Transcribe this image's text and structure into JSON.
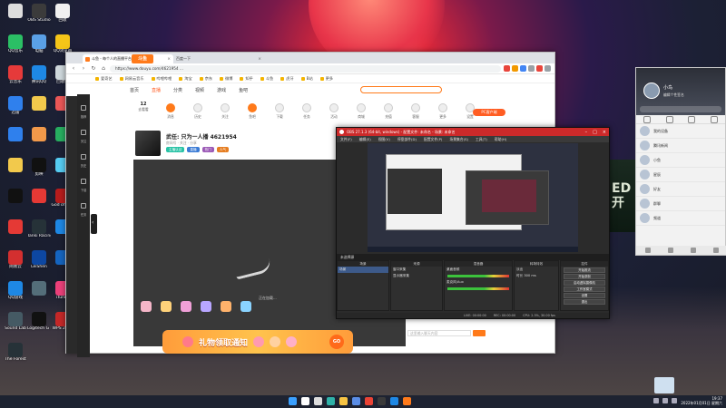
{
  "desktop": {
    "icons": [
      {
        "label": "",
        "color": "#dddddd"
      },
      {
        "label": "OBS Studio",
        "color": "#3b3b3b"
      },
      {
        "label": "回收",
        "color": "#f0f0f0"
      },
      {
        "label": "斗鱼直播",
        "color": "#ff7a1a"
      },
      {
        "label": "QQ音乐",
        "color": "#2bbf65"
      },
      {
        "label": "电脑",
        "color": "#5aa0e6"
      },
      {
        "label": "QQ浏览器",
        "color": "#f5c518"
      },
      {
        "label": "斗鱼助手",
        "color": "#3a8ee6"
      },
      {
        "label": "云音乐",
        "color": "#e63a3a"
      },
      {
        "label": "腾讯QQ",
        "color": "#1e88e5"
      },
      {
        "label": "回收站",
        "color": "#cfd8dc"
      },
      {
        "label": "WeGame",
        "color": "#2a2a2a"
      },
      {
        "label": "迅雷",
        "color": "#2f80ed"
      },
      {
        "label": "",
        "color": "#f2c94c"
      },
      {
        "label": "",
        "color": "#eb5757"
      },
      {
        "label": "",
        "color": "#f2c94c"
      },
      {
        "label": "",
        "color": "#2f80ed"
      },
      {
        "label": "",
        "color": "#f2994a"
      },
      {
        "label": "",
        "color": "#27ae60"
      },
      {
        "label": "",
        "color": "#9b51e0"
      },
      {
        "label": "",
        "color": "#f2c94c"
      },
      {
        "label": "剪映",
        "color": "#111111"
      },
      {
        "label": "",
        "color": "#56ccf2"
      },
      {
        "label": "Xuni Lab",
        "color": "#3f51b5"
      },
      {
        "label": "",
        "color": "#111"
      },
      {
        "label": "",
        "color": "#e53935"
      },
      {
        "label": "God of War",
        "color": "#b71c1c"
      },
      {
        "label": "",
        "color": "#333"
      },
      {
        "label": "",
        "color": "#e53935"
      },
      {
        "label": "Tanki Racing",
        "color": "#263238"
      },
      {
        "label": "",
        "color": "#1e88e5"
      },
      {
        "label": "",
        "color": "#ffffff"
      },
      {
        "label": "网易云",
        "color": "#d32f2f"
      },
      {
        "label": "LeiShen",
        "color": "#0d47a1"
      },
      {
        "label": "",
        "color": "#1565c0"
      },
      {
        "label": "GeForce Experience",
        "color": "#76b900"
      },
      {
        "label": "QQ游戏",
        "color": "#1e88e5"
      },
      {
        "label": "",
        "color": "#546e7a"
      },
      {
        "label": "iTunes",
        "color": "#ec407a"
      },
      {
        "label": "steam",
        "color": "#1b2838"
      },
      {
        "label": "Sound Lab",
        "color": "#455a64"
      },
      {
        "label": "Logitech G HUB",
        "color": "#111"
      },
      {
        "label": "WPS 2019",
        "color": "#c62828"
      },
      {
        "label": "",
        "color": "#fbc02d"
      },
      {
        "label": "The Forest",
        "color": "#263238"
      }
    ]
  },
  "browser": {
    "tabs": [
      {
        "label": "斗鱼 - 每个人的直播平台",
        "active": true
      },
      {
        "label": "百度一下",
        "active": false
      }
    ],
    "url": "https://www.douyu.com/4621954 ...",
    "bookmarks": [
      "爱奇艺",
      "网易云音乐",
      "哔哩哔哩",
      "淘宝",
      "京东",
      "微博",
      "知乎",
      "斗鱼",
      "虎牙",
      "B站",
      "更多"
    ],
    "douyu": {
      "logo": "斗鱼",
      "nav": [
        "首页",
        "直播",
        "分类",
        "视频",
        "游戏",
        "鱼吧"
      ],
      "active_nav": "直播",
      "features": [
        {
          "value": "12",
          "label": "去看看"
        },
        {
          "value": "",
          "label": "消息"
        },
        {
          "value": "",
          "label": "历史"
        },
        {
          "value": "",
          "label": "关注"
        },
        {
          "value": "",
          "label": "鱼吧"
        },
        {
          "value": "",
          "label": "下载"
        },
        {
          "value": "",
          "label": "任务"
        },
        {
          "value": "",
          "label": "活动"
        },
        {
          "value": "",
          "label": "商城"
        },
        {
          "value": "",
          "label": "充值"
        },
        {
          "value": "",
          "label": "客服"
        },
        {
          "value": "",
          "label": "更多"
        },
        {
          "value": "",
          "label": "设置"
        }
      ],
      "pc_button": "PC客户端",
      "room_title": "武任: 只为一人播 4621954",
      "room_sub": "房间号 · 关注 · 分享",
      "tags": [
        {
          "label": "主播认证",
          "color": "#27c2a5"
        },
        {
          "label": "直播",
          "color": "#3a7bd5"
        },
        {
          "label": "热门",
          "color": "#9b59b6"
        },
        {
          "label": "人气",
          "color": "#e67e22"
        }
      ],
      "player_loading": "正在加载...",
      "banner_title": "礼物领取通知",
      "banner_go": "GO",
      "chat_placeholder": "这里输入聊天内容",
      "sidebar": [
        "推荐",
        "关注",
        "历史",
        "下载",
        "任务"
      ]
    }
  },
  "obs": {
    "title": "OBS 27.1.3 (64-bit, windows) - 配置文件: 未命名 - 场景: 未命名",
    "menu": [
      "文件(F)",
      "编辑(E)",
      "视图(V)",
      "停靠部件(D)",
      "配置文件(P)",
      "场景集合(S)",
      "工具(T)",
      "帮助(H)"
    ],
    "scene_bar": "未选择源",
    "docks": {
      "scenes": {
        "header": "场景",
        "items": [
          "场景"
        ]
      },
      "sources": {
        "header": "来源",
        "items": [
          "窗口采集",
          "显示器采集"
        ]
      },
      "mixer": {
        "header": "混音器",
        "items": [
          "桌面音频",
          "麦克风/Aux"
        ]
      },
      "transitions": {
        "header": "转场特效",
        "items": [
          "淡出",
          "时长 300 ms"
        ]
      },
      "controls": {
        "header": "控件",
        "buttons": [
          "开始推流",
          "开始录制",
          "启动虚拟摄像机",
          "工作室模式",
          "设置",
          "退出"
        ]
      }
    },
    "status": [
      "LIVE: 00:00:00",
      "REC: 00:00:00",
      "CPU: 2.3%, 30.00 fps"
    ]
  },
  "qq": {
    "name": "小鸟",
    "signature": "编辑个性签名",
    "contacts": [
      {
        "name": "我的设备",
        "status": ""
      },
      {
        "name": "腾讯新闻",
        "status": ""
      },
      {
        "name": "小鱼",
        "status": ""
      },
      {
        "name": "星辰",
        "status": ""
      },
      {
        "name": "好友",
        "status": ""
      },
      {
        "name": "群聊",
        "status": ""
      },
      {
        "name": "频道",
        "status": ""
      }
    ]
  },
  "taskbar": {
    "apps": [
      {
        "name": "windows-start",
        "color": "#3aa0ff"
      },
      {
        "name": "search",
        "color": "#ffffff"
      },
      {
        "name": "task-view",
        "color": "#dddddd"
      },
      {
        "name": "edge",
        "color": "#2fb2a8"
      },
      {
        "name": "explorer",
        "color": "#f6c343"
      },
      {
        "name": "store",
        "color": "#5a8de6"
      },
      {
        "name": "chrome",
        "color": "#ea4335"
      },
      {
        "name": "obs",
        "color": "#3a3a3a"
      },
      {
        "name": "qq",
        "color": "#1e88e5"
      },
      {
        "name": "douyu",
        "color": "#ff7a1a"
      }
    ],
    "time": "19:37",
    "date": "2022年01月01日 星期六"
  },
  "game_strip_text": "ED\n开"
}
